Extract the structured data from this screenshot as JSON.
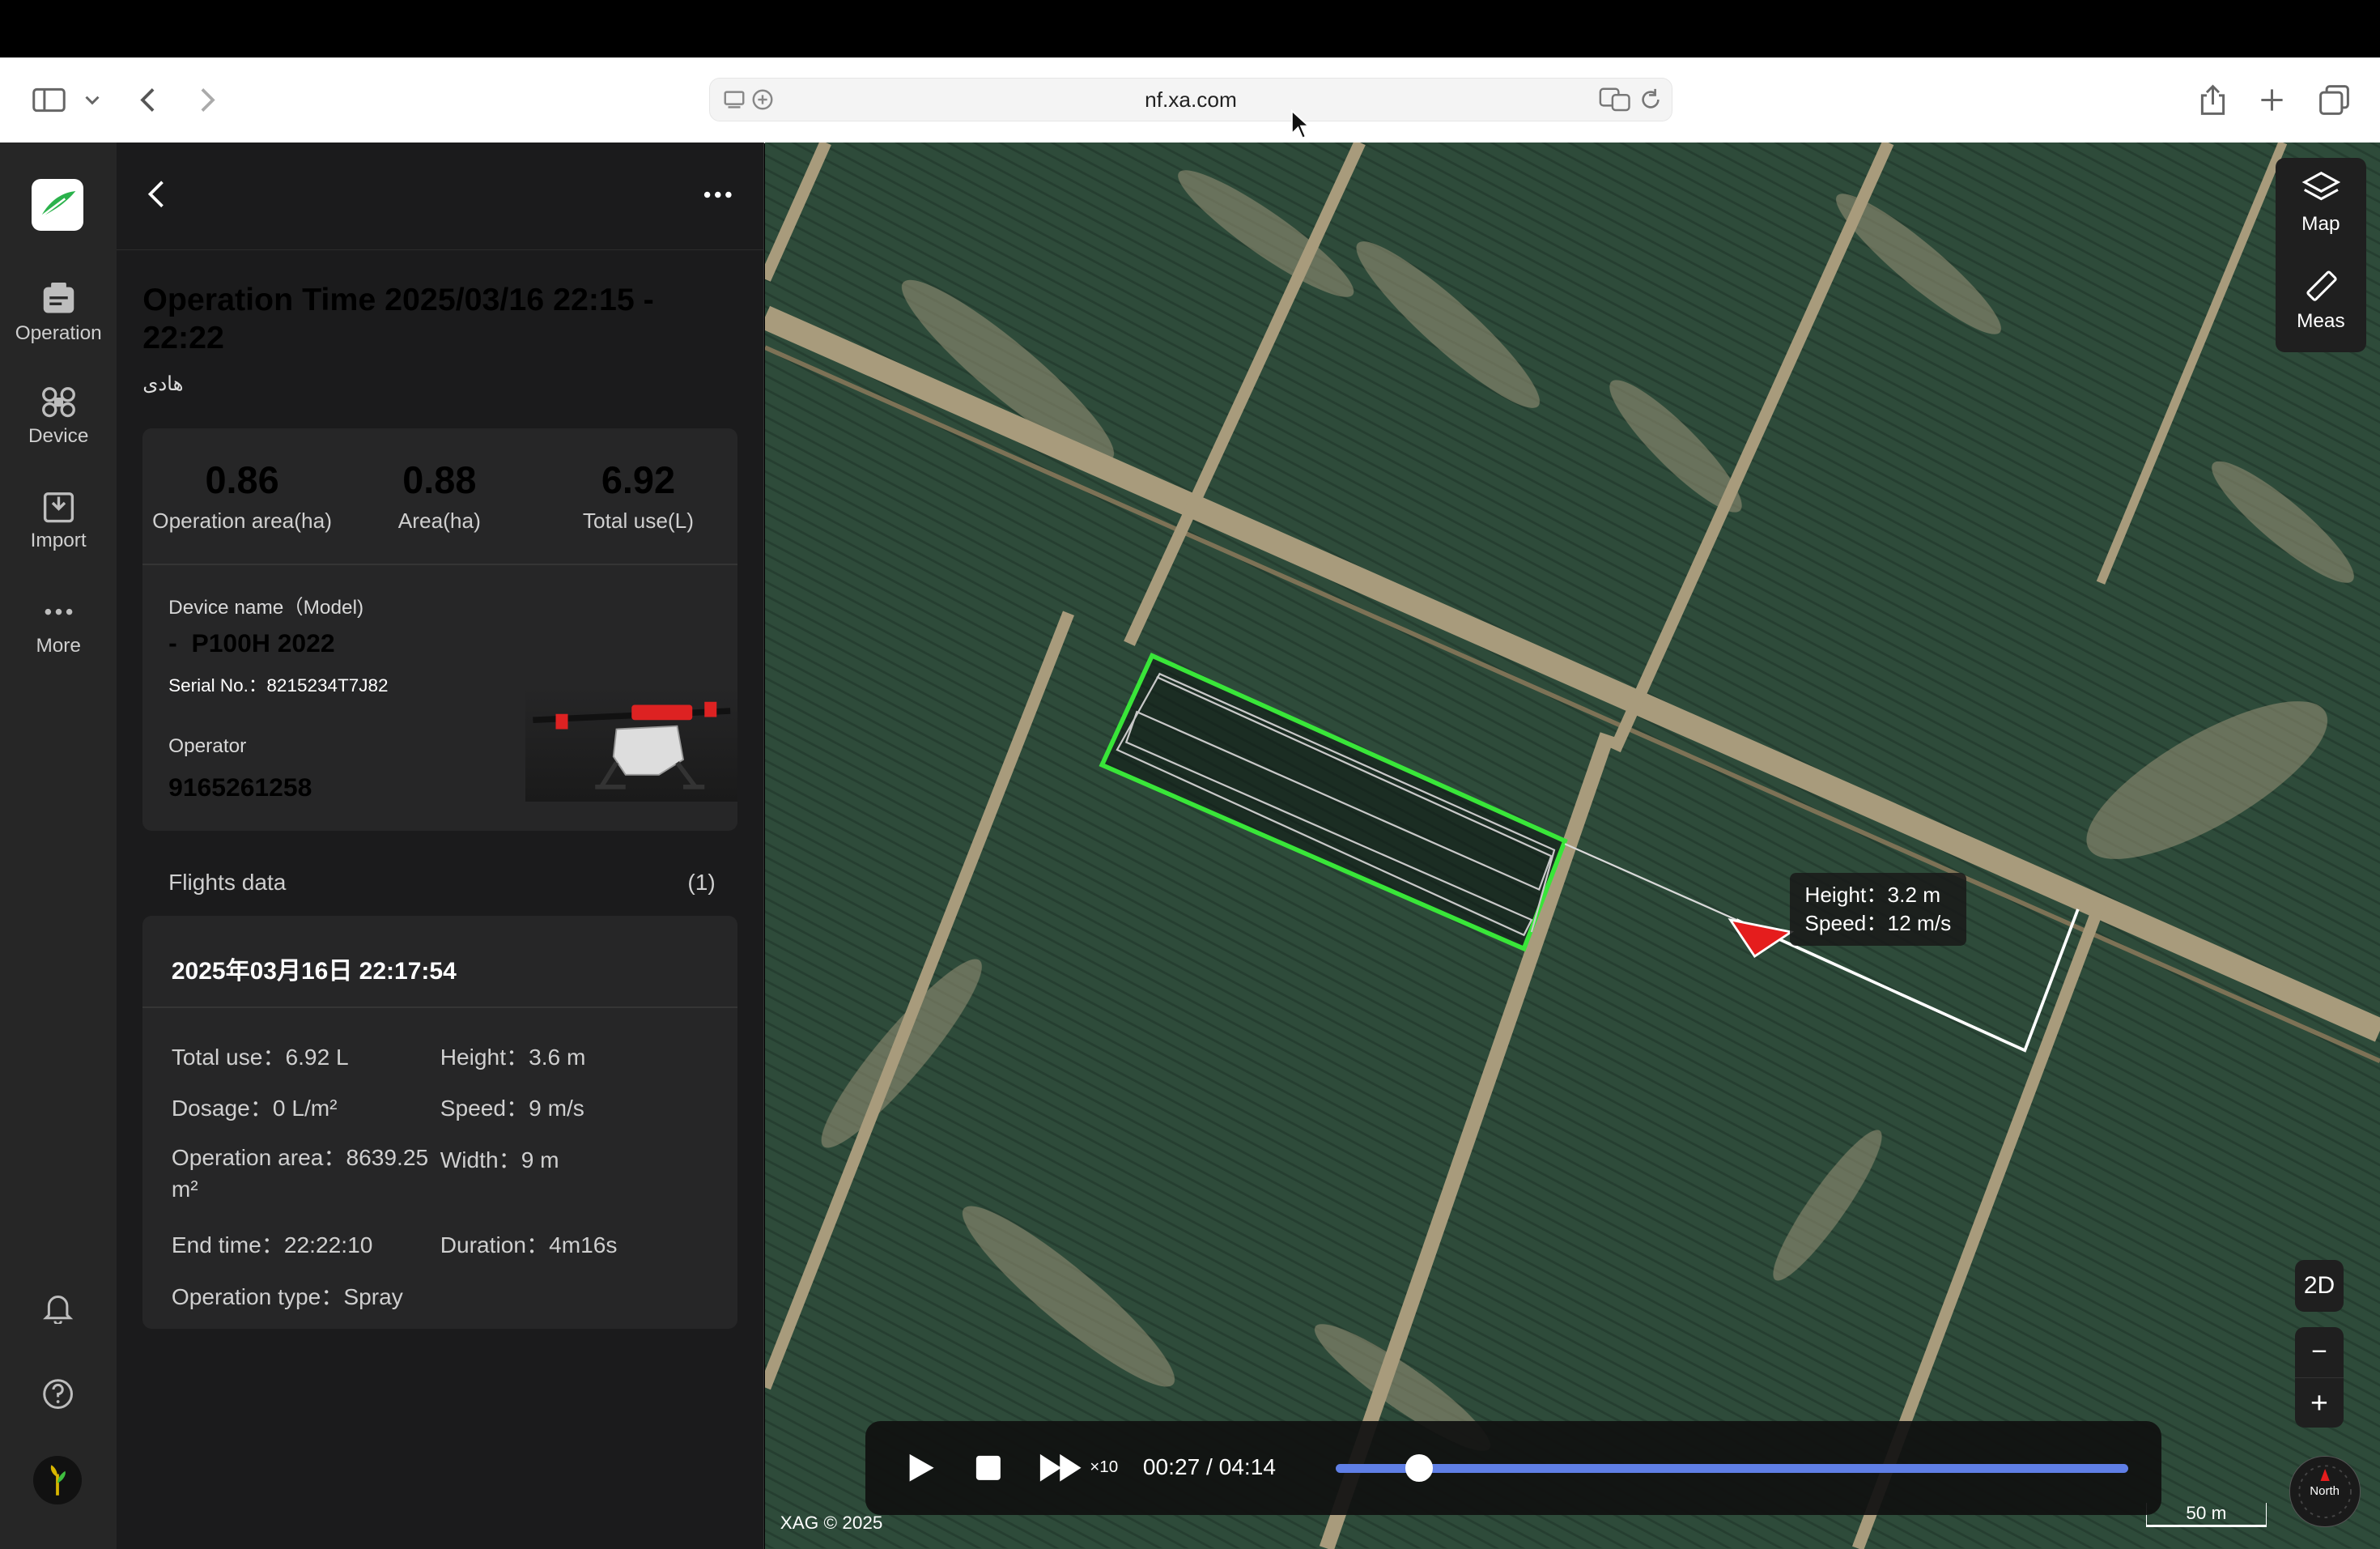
{
  "browser": {
    "url": "nf.xa.com"
  },
  "rail": {
    "items": [
      {
        "label": "Operation",
        "icon": "operation-icon"
      },
      {
        "label": "Device",
        "icon": "drone-icon"
      },
      {
        "label": "Import",
        "icon": "import-icon"
      },
      {
        "label": "More",
        "icon": "more-icon"
      }
    ]
  },
  "panel": {
    "title": "Operation Time 2025/03/16 22:15 - 22:22",
    "subtitle": "هادی",
    "stats": [
      {
        "value": "0.86",
        "label": "Operation area(ha)"
      },
      {
        "value": "0.88",
        "label": "Area(ha)"
      },
      {
        "value": "6.92",
        "label": "Total use(L)"
      }
    ],
    "device": {
      "name_label": "Device name（Model)",
      "name": "-  P100H 2022",
      "serial": "Serial No.：8215234T7J82",
      "operator_label": "Operator",
      "operator": "9165261258"
    },
    "flights": {
      "label": "Flights data",
      "count": "(1)",
      "flight_title": "2025年03月16日 22:17:54",
      "details": {
        "total_use": "Total use：6.92 L",
        "height": "Height：3.6 m",
        "dosage": "Dosage：0 L/m²",
        "speed": "Speed：9 m/s",
        "operation_area": "Operation area：8639.25 m²",
        "width": "Width：9 m",
        "end_time": "End time：22:22:10",
        "duration": "Duration：4m16s",
        "operation_type": "Operation type：Spray"
      }
    }
  },
  "map": {
    "controls": {
      "map": "Map",
      "meas": "Meas",
      "mode": "2D",
      "zoom_out": "−",
      "zoom_in": "+"
    },
    "tooltip": {
      "height": "Height：3.2 m",
      "speed": "Speed：12 m/s"
    },
    "copyright": "XAG © 2025",
    "scale": "50 m",
    "compass": "North"
  },
  "player": {
    "speed": "×10",
    "time": "00:27 / 04:14",
    "progress": 0.105
  },
  "colors": {
    "field_outline": "#39e639",
    "drone_marker": "#e51d1d",
    "progress": "#5f7fe6"
  }
}
